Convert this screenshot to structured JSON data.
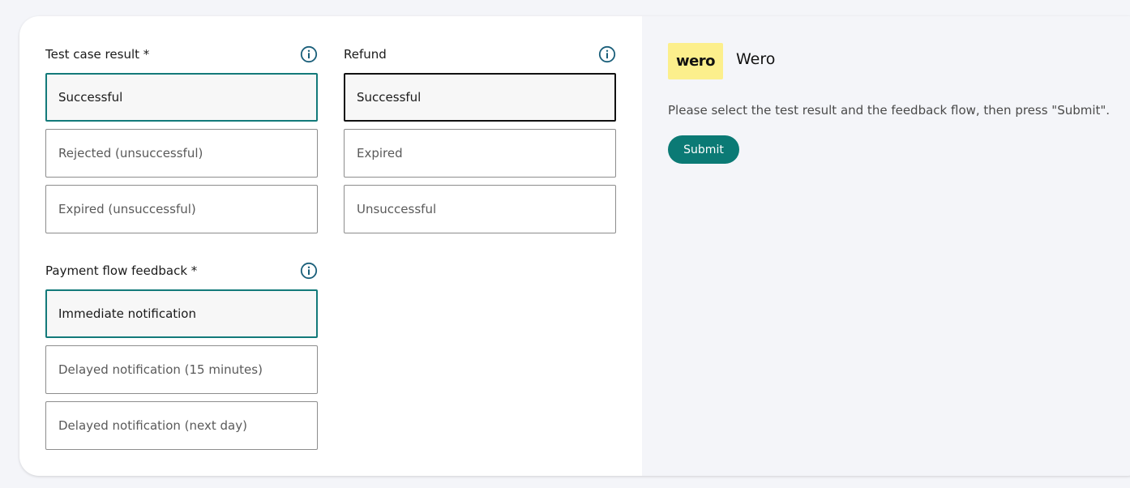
{
  "test_case_result": {
    "label": "Test case result *",
    "options": [
      "Successful",
      "Rejected (unsuccessful)",
      "Expired (unsuccessful)"
    ],
    "selected": "Successful"
  },
  "refund": {
    "label": "Refund",
    "options": [
      "Successful",
      "Expired",
      "Unsuccessful"
    ],
    "selected": "Successful"
  },
  "payment_flow_feedback": {
    "label": "Payment flow feedback *",
    "options": [
      "Immediate notification",
      "Delayed notification (15 minutes)",
      "Delayed notification (next day)"
    ],
    "selected": "Immediate notification"
  },
  "brand": {
    "logo_text": "wero",
    "name": "Wero"
  },
  "instructions": "Please select the test result and the feedback flow, then press \"Submit\".",
  "submit_label": "Submit",
  "colors": {
    "accent": "#0b7a75",
    "selected_border": "#137a7a",
    "logo_bg": "#fcef8c",
    "panel_bg": "#f4f5f9"
  }
}
